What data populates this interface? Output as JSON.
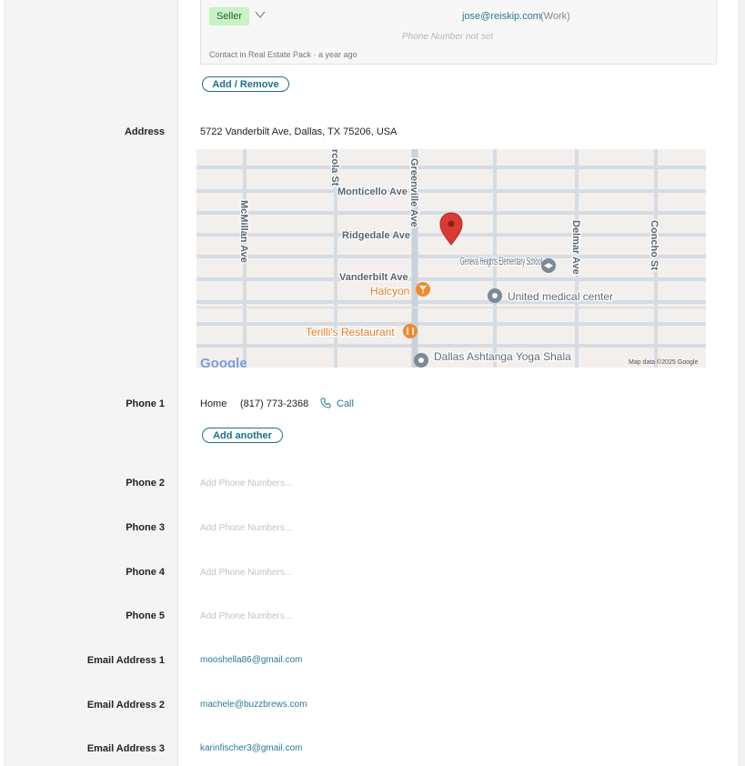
{
  "contact_card": {
    "role_badge": "Seller",
    "email": "jose@reiskip.com",
    "email_type": "(Work)",
    "phone_placeholder": "Phone Number not set",
    "footer": "Contact in Real Estate Pack · a year ago"
  },
  "buttons": {
    "add_remove": "Add / Remove",
    "add_another": "Add another"
  },
  "address": {
    "label": "Address",
    "value": "5722 Vanderbilt Ave, Dallas, TX 75206, USA",
    "map": {
      "streets": [
        "Monticello Ave",
        "Ridgedale Ave",
        "Vanderbilt Ave",
        "Greenville Ave",
        "McMillan Ave",
        "rcola St",
        "Delmar Ave",
        "Concho St"
      ],
      "places": [
        "Geneva Heights Elementary School",
        "Halcyon",
        "United medical center",
        "Terilli's Restaurant",
        "Dallas Ashtanga Yoga Shala"
      ],
      "attribution": "Map data ©2025 Google",
      "logo_text": "Google",
      "colors": {
        "road": "#d6dce3",
        "background": "#f2efed",
        "pin": "#d83a34",
        "food": "#ef8a32",
        "poi": "#7b8a99"
      }
    }
  },
  "phones": [
    {
      "label": "Phone 1",
      "type": "Home",
      "number": "(817) 773-2368",
      "action": "Call"
    },
    {
      "label": "Phone 2",
      "placeholder": "Add Phone Numbers..."
    },
    {
      "label": "Phone 3",
      "placeholder": "Add Phone Numbers..."
    },
    {
      "label": "Phone 4",
      "placeholder": "Add Phone Numbers..."
    },
    {
      "label": "Phone 5",
      "placeholder": "Add Phone Numbers..."
    }
  ],
  "emails": [
    {
      "label": "Email Address 1",
      "value": "mooshella86@gmail.com"
    },
    {
      "label": "Email Address 2",
      "value": "machele@buzzbrews.com"
    },
    {
      "label": "Email Address 3",
      "value": "karinfischer3@gmail.com"
    }
  ],
  "colors": {
    "link": "#2a7a97",
    "button": "#1f6f8b",
    "badge_bg": "#c8f3c4"
  }
}
